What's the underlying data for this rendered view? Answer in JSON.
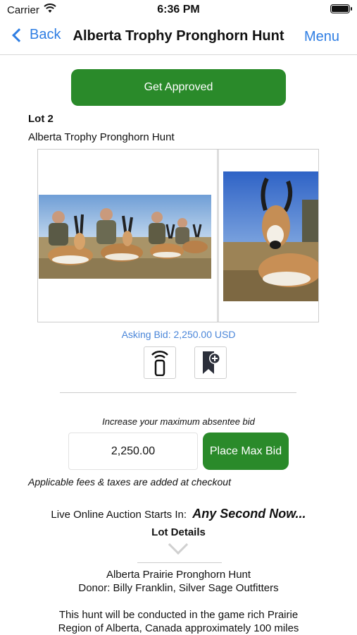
{
  "status_bar": {
    "carrier": "Carrier",
    "time": "6:36 PM"
  },
  "nav": {
    "back_label": "Back",
    "title": "Alberta Trophy Pronghorn Hunt",
    "menu_label": "Menu"
  },
  "approve_label": "Get Approved",
  "lot": {
    "number": "Lot 2",
    "title": "Alberta Trophy Pronghorn Hunt"
  },
  "gallery": {
    "photos": [
      "hunters-with-pronghorns",
      "pronghorn-closeup"
    ]
  },
  "asking_bid": "Asking Bid: 2,250.00 USD",
  "icons": {
    "remote": "remote-bidding-icon",
    "watchlist": "bookmark-add-icon"
  },
  "bid": {
    "increase_label": "Increase your maximum absentee bid",
    "value": "2,250.00",
    "place_label": "Place Max Bid",
    "fees_note": "Applicable fees & taxes are added at checkout"
  },
  "auction": {
    "starts_label": "Live Online Auction Starts In:",
    "countdown": "Any Second Now..."
  },
  "details": {
    "heading": "Lot Details",
    "lines": [
      "Alberta Prairie Pronghorn Hunt",
      "Donor: Billy Franklin, Silver Sage Outfitters",
      "This hunt will be conducted in the game rich Prairie",
      "Region of Alberta, Canada approximately 100 miles"
    ]
  },
  "colors": {
    "accent_blue": "#2f7ee3",
    "button_green": "#2a8a2a",
    "asking_bid_blue": "#4a86d9"
  }
}
